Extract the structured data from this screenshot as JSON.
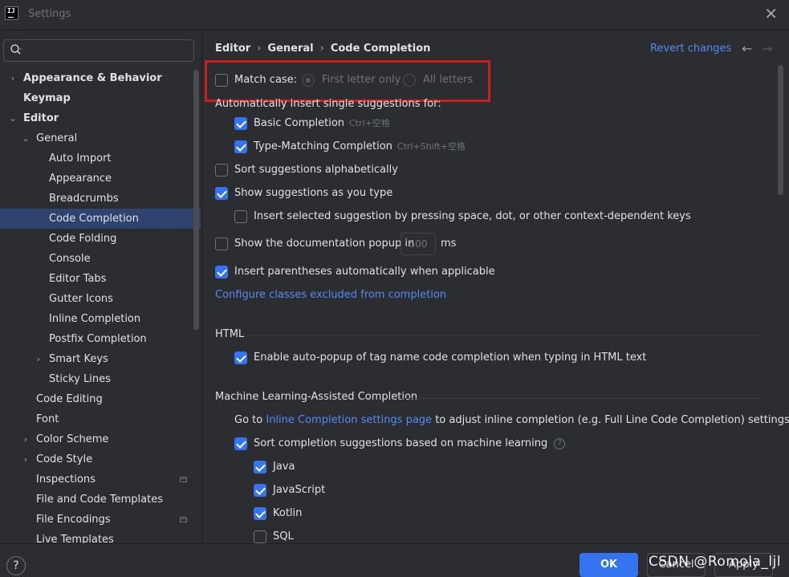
{
  "window": {
    "title": "Settings",
    "app_icon_text": "IJ",
    "close_glyph": "✕"
  },
  "search": {
    "placeholder": "",
    "icon": "search-icon"
  },
  "sidebar": {
    "items": [
      {
        "label": "Appearance & Behavior",
        "level": 0,
        "arrow": "›",
        "bold": true
      },
      {
        "label": "Keymap",
        "level": 0,
        "arrow": "",
        "bold": true
      },
      {
        "label": "Editor",
        "level": 0,
        "arrow": "⌄",
        "bold": true
      },
      {
        "label": "General",
        "level": 1,
        "arrow": "⌄",
        "bold": false
      },
      {
        "label": "Auto Import",
        "level": 2,
        "arrow": "",
        "bold": false
      },
      {
        "label": "Appearance",
        "level": 2,
        "arrow": "",
        "bold": false
      },
      {
        "label": "Breadcrumbs",
        "level": 2,
        "arrow": "",
        "bold": false
      },
      {
        "label": "Code Completion",
        "level": 2,
        "arrow": "",
        "bold": false,
        "selected": true
      },
      {
        "label": "Code Folding",
        "level": 2,
        "arrow": "",
        "bold": false
      },
      {
        "label": "Console",
        "level": 2,
        "arrow": "",
        "bold": false
      },
      {
        "label": "Editor Tabs",
        "level": 2,
        "arrow": "",
        "bold": false
      },
      {
        "label": "Gutter Icons",
        "level": 2,
        "arrow": "",
        "bold": false
      },
      {
        "label": "Inline Completion",
        "level": 2,
        "arrow": "",
        "bold": false
      },
      {
        "label": "Postfix Completion",
        "level": 2,
        "arrow": "",
        "bold": false
      },
      {
        "label": "Smart Keys",
        "level": 2,
        "arrow": "›",
        "bold": false
      },
      {
        "label": "Sticky Lines",
        "level": 2,
        "arrow": "",
        "bold": false
      },
      {
        "label": "Code Editing",
        "level": 1,
        "arrow": "",
        "bold": false
      },
      {
        "label": "Font",
        "level": 1,
        "arrow": "",
        "bold": false
      },
      {
        "label": "Color Scheme",
        "level": 1,
        "arrow": "›",
        "bold": false
      },
      {
        "label": "Code Style",
        "level": 1,
        "arrow": "›",
        "bold": false
      },
      {
        "label": "Inspections",
        "level": 1,
        "arrow": "",
        "bold": false,
        "badge": true
      },
      {
        "label": "File and Code Templates",
        "level": 1,
        "arrow": "",
        "bold": false
      },
      {
        "label": "File Encodings",
        "level": 1,
        "arrow": "",
        "bold": false,
        "badge": true
      },
      {
        "label": "Live Templates",
        "level": 1,
        "arrow": "",
        "bold": false
      }
    ]
  },
  "header": {
    "breadcrumb": [
      "Editor",
      "General",
      "Code Completion"
    ],
    "separator": "›",
    "revert_label": "Revert changes",
    "back_glyph": "←",
    "forward_glyph": "→"
  },
  "main": {
    "match_case": {
      "label": "Match case:",
      "checked": false,
      "options": [
        "First letter only",
        "All letters"
      ],
      "selected": "First letter only"
    },
    "auto_insert_heading": "Automatically insert single suggestions for:",
    "basic_completion": {
      "label": "Basic Completion",
      "shortcut": "Ctrl+空格",
      "checked": true
    },
    "type_matching": {
      "label": "Type-Matching Completion",
      "shortcut": "Ctrl+Shift+空格",
      "checked": true
    },
    "sort_alpha": {
      "label": "Sort suggestions alphabetically",
      "checked": false
    },
    "show_as_type": {
      "label": "Show suggestions as you type",
      "checked": true
    },
    "insert_selected": {
      "label": "Insert selected suggestion by pressing space, dot, or other context-dependent keys",
      "checked": false
    },
    "doc_popup": {
      "label": "Show the documentation popup in",
      "value": "500",
      "unit": "ms",
      "checked": false
    },
    "insert_parens": {
      "label": "Insert parentheses automatically when applicable",
      "checked": true
    },
    "configure_link": "Configure classes excluded from completion",
    "html_section": "HTML",
    "html_autopopup": {
      "label": "Enable auto-popup of tag name code completion when typing in HTML text",
      "checked": true
    },
    "ml_section": "Machine Learning-Assisted Completion",
    "goto_prefix": "Go to",
    "goto_link": "Inline Completion settings page",
    "goto_suffix": "to adjust inline completion (e.g. Full Line Code Completion) settings",
    "ml_sort": {
      "label": "Sort completion suggestions based on machine learning",
      "checked": true,
      "help": "?"
    },
    "languages": [
      {
        "label": "Java",
        "checked": true
      },
      {
        "label": "JavaScript",
        "checked": true
      },
      {
        "label": "Kotlin",
        "checked": true
      },
      {
        "label": "SQL",
        "checked": false
      }
    ]
  },
  "footer": {
    "help": "?",
    "ok": "OK",
    "cancel": "Cancel",
    "apply": "Apply",
    "watermark": "CSDN @Romola_ljl"
  },
  "colors": {
    "accent": "#3574f0",
    "link": "#548af7",
    "highlight_box": "#d01c1c",
    "selection": "#2e436e",
    "background": "#2b2d30"
  }
}
